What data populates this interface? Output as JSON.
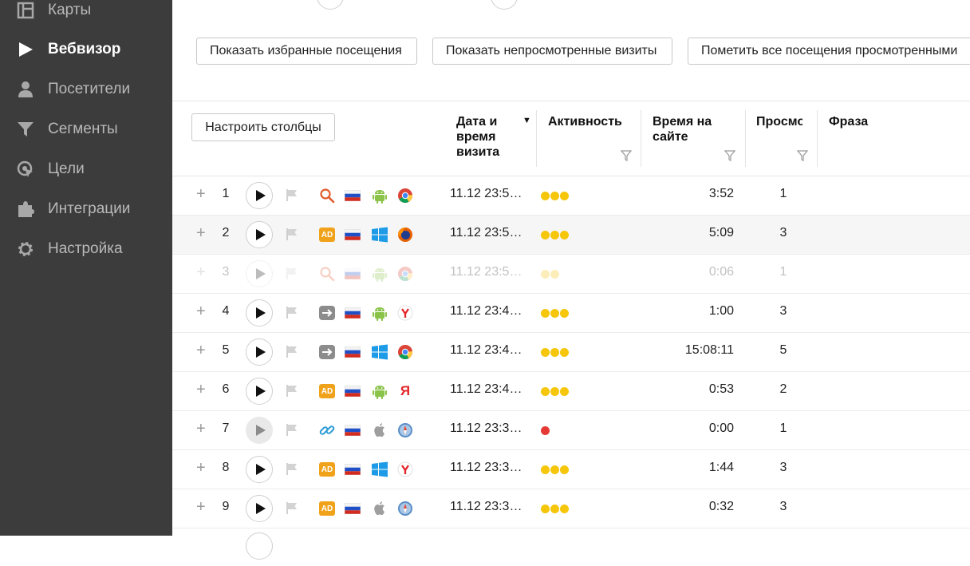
{
  "sidebar": {
    "items": [
      {
        "label": "Карты",
        "icon": "map-icon"
      },
      {
        "label": "Вебвизор",
        "icon": "play-icon",
        "active": true
      },
      {
        "label": "Посетители",
        "icon": "user-icon"
      },
      {
        "label": "Сегменты",
        "icon": "filter-icon"
      },
      {
        "label": "Цели",
        "icon": "target-icon"
      },
      {
        "label": "Интеграции",
        "icon": "puzzle-icon"
      },
      {
        "label": "Настройка",
        "icon": "gear-icon"
      }
    ]
  },
  "toolbar": {
    "show_favorites": "Показать избранные посещения",
    "show_unviewed": "Показать непросмотренные визиты",
    "mark_all_viewed": "Пометить все посещения просмотренными"
  },
  "table": {
    "configure_columns": "Настроить столбцы",
    "columns": {
      "date": "Дата и время визита",
      "activity": "Активность",
      "time_on_site": "Время на сайте",
      "views": "Просмотры",
      "phrase": "Фраза"
    },
    "rows": [
      {
        "num": "1",
        "source": "search-icon",
        "country": "russia-flag-icon",
        "os": "android-icon",
        "browser": "chrome-icon",
        "date": "11.12 23:5…",
        "activity": 3,
        "duration": "3:52",
        "views": "1",
        "highlighted": false,
        "faded": false
      },
      {
        "num": "2",
        "source": "ad-icon",
        "country": "russia-flag-icon",
        "os": "windows-icon",
        "browser": "firefox-icon",
        "date": "11.12 23:5…",
        "activity": 3,
        "duration": "5:09",
        "views": "3",
        "highlighted": true,
        "faded": false
      },
      {
        "num": "3",
        "source": "search-icon",
        "country": "russia-flag-icon",
        "os": "android-icon",
        "browser": "chrome-icon",
        "date": "11.12 23:5…",
        "activity": 2,
        "duration": "0:06",
        "views": "1",
        "highlighted": false,
        "faded": true
      },
      {
        "num": "4",
        "source": "direct-icon",
        "country": "russia-flag-icon",
        "os": "android-icon",
        "browser": "yandex-browser-icon",
        "date": "11.12 23:4…",
        "activity": 3,
        "duration": "1:00",
        "views": "3",
        "highlighted": false,
        "faded": false
      },
      {
        "num": "5",
        "source": "direct-icon",
        "country": "russia-flag-icon",
        "os": "windows-icon",
        "browser": "chrome-icon",
        "date": "11.12 23:4…",
        "activity": 3,
        "duration": "15:08:11",
        "views": "5",
        "highlighted": false,
        "faded": false
      },
      {
        "num": "6",
        "source": "ad-icon",
        "country": "russia-flag-icon",
        "os": "android-icon",
        "browser": "yandex-icon",
        "date": "11.12 23:4…",
        "activity": 3,
        "duration": "0:53",
        "views": "2",
        "highlighted": false,
        "faded": false
      },
      {
        "num": "7",
        "source": "link-icon",
        "country": "russia-flag-icon",
        "os": "apple-icon",
        "browser": "safari-icon",
        "date": "11.12 23:3…",
        "activity": 1,
        "duration": "0:00",
        "views": "1",
        "highlighted": false,
        "faded": false,
        "play_disabled": true
      },
      {
        "num": "8",
        "source": "ad-icon",
        "country": "russia-flag-icon",
        "os": "windows-icon",
        "browser": "yandex-browser-icon",
        "date": "11.12 23:3…",
        "activity": 3,
        "duration": "1:44",
        "views": "3",
        "highlighted": false,
        "faded": false
      },
      {
        "num": "9",
        "source": "ad-icon",
        "country": "russia-flag-icon",
        "os": "apple-icon",
        "browser": "safari-icon",
        "date": "11.12 23:3…",
        "activity": 3,
        "duration": "0:32",
        "views": "3",
        "highlighted": false,
        "faded": false
      }
    ]
  },
  "colors": {
    "sidebar_bg": "#3c3c3c",
    "activity_dot": "#f5c60a",
    "activity_dot_low": "#e53935",
    "ad_badge": "#f0a21b"
  }
}
